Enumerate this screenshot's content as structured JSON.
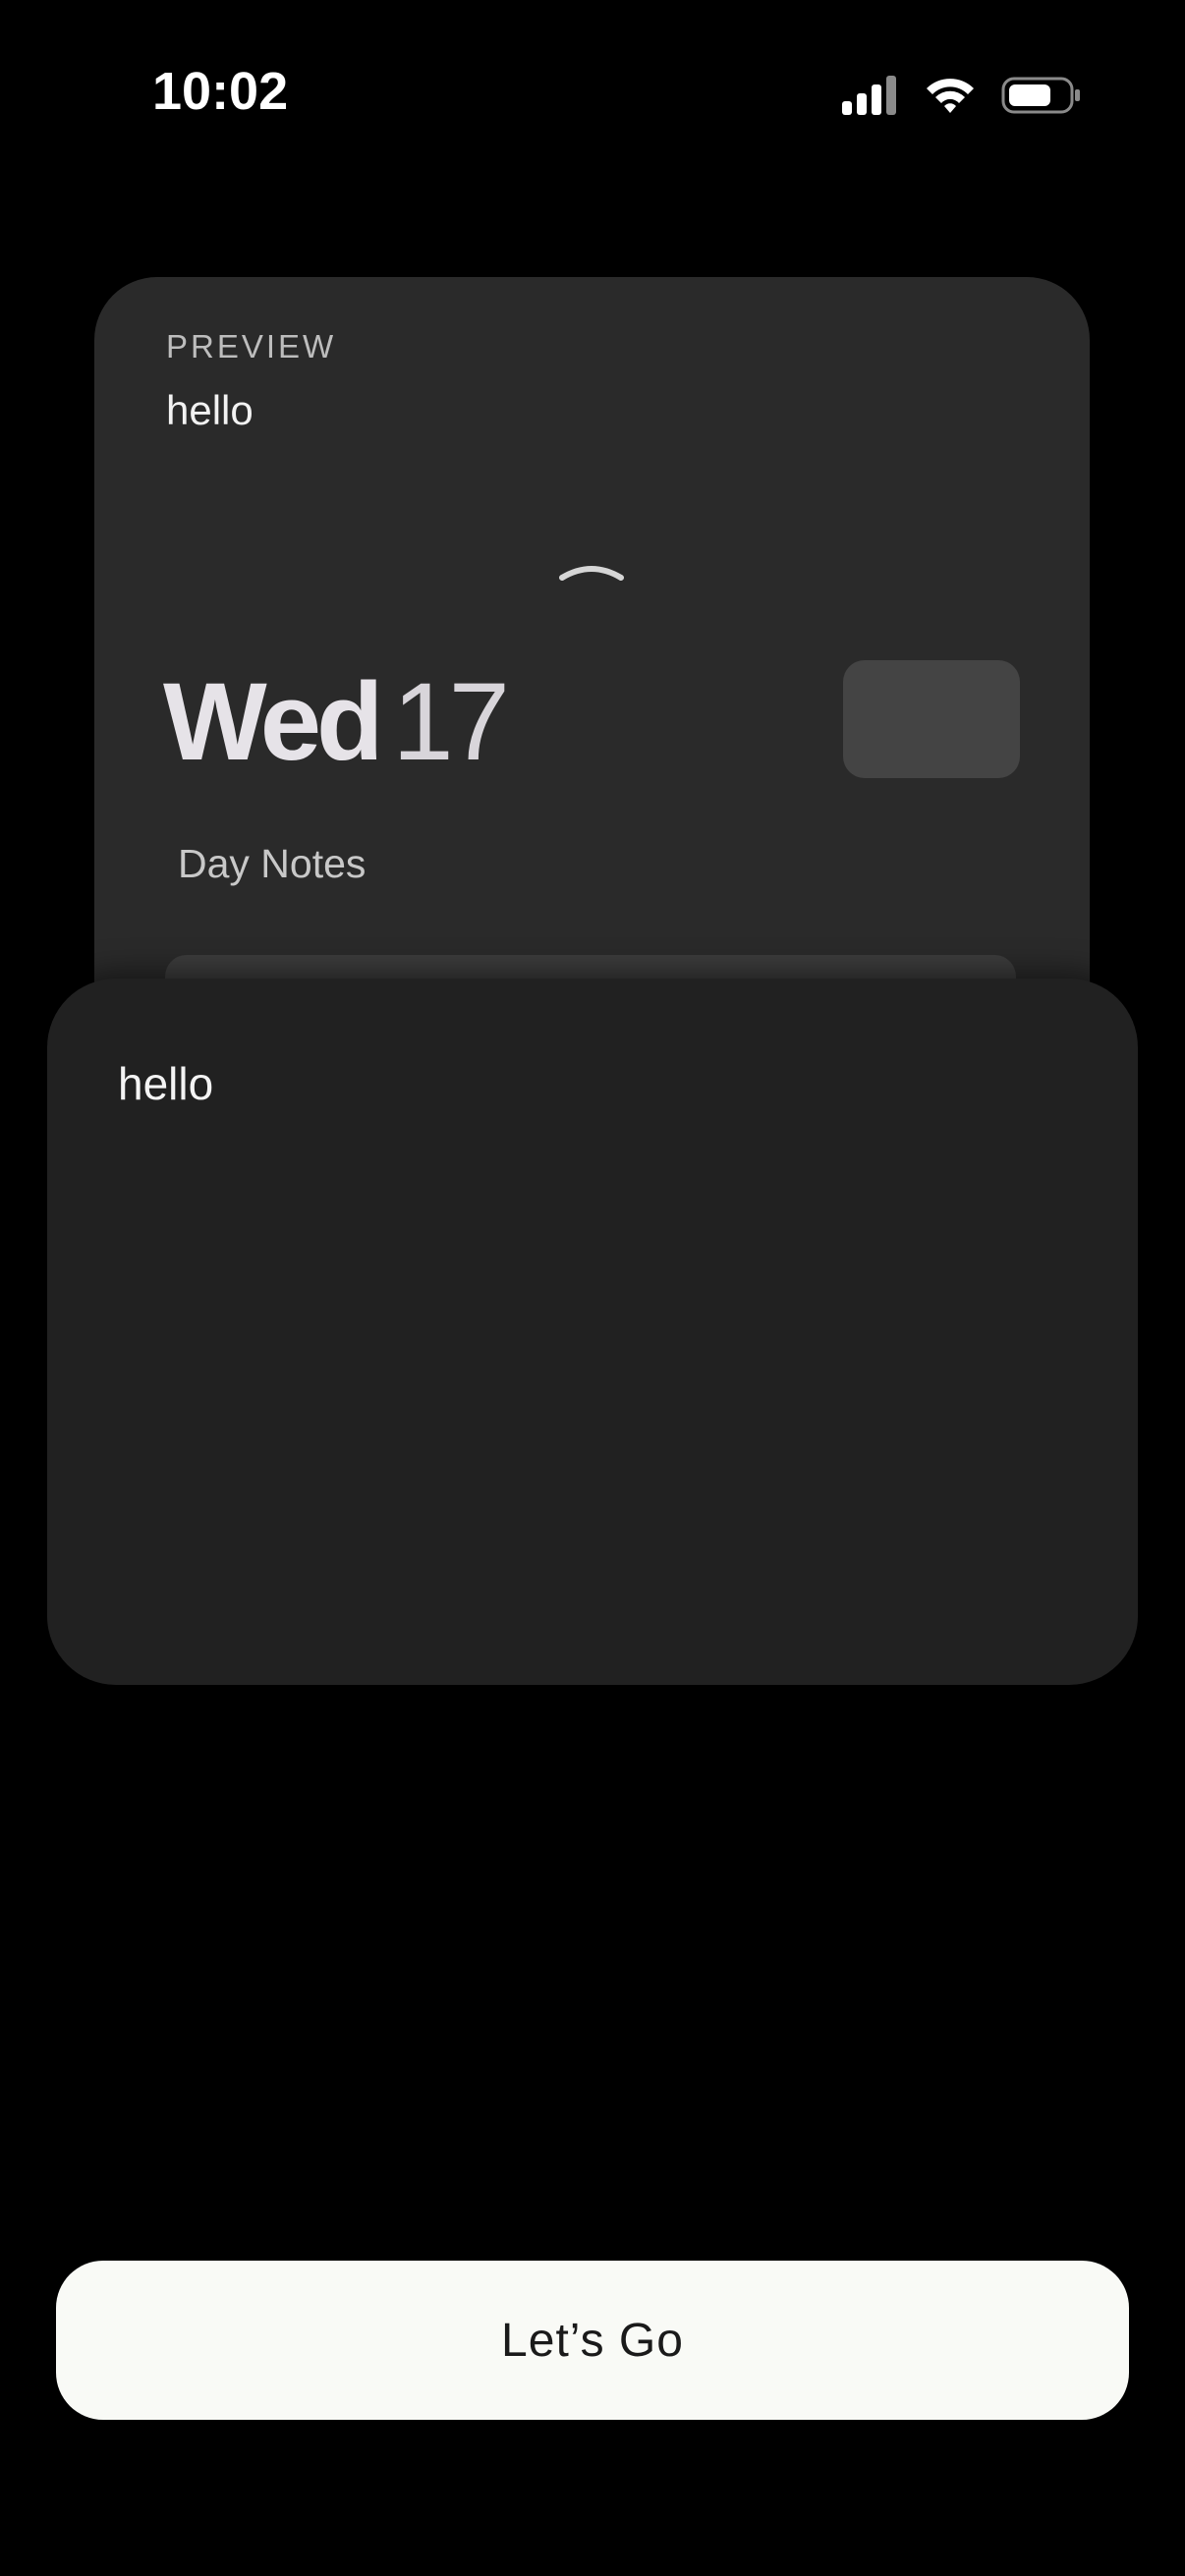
{
  "status_bar": {
    "time": "10:02",
    "icons": [
      "cellular-signal-icon",
      "wifi-icon",
      "battery-icon"
    ]
  },
  "preview_card": {
    "label": "PREVIEW",
    "text": "hello",
    "chevron_icon": "chevron-up-icon",
    "weekday": "Wed",
    "day": "17",
    "section_title": "Day Notes"
  },
  "note_card": {
    "text": "hello"
  },
  "cta": {
    "label": "Let’s Go"
  },
  "colors": {
    "background": "#000000",
    "preview_card": "#2a2a2a",
    "note_card": "#212121",
    "button": "#f9faf6",
    "button_text": "#1a1a1a"
  }
}
